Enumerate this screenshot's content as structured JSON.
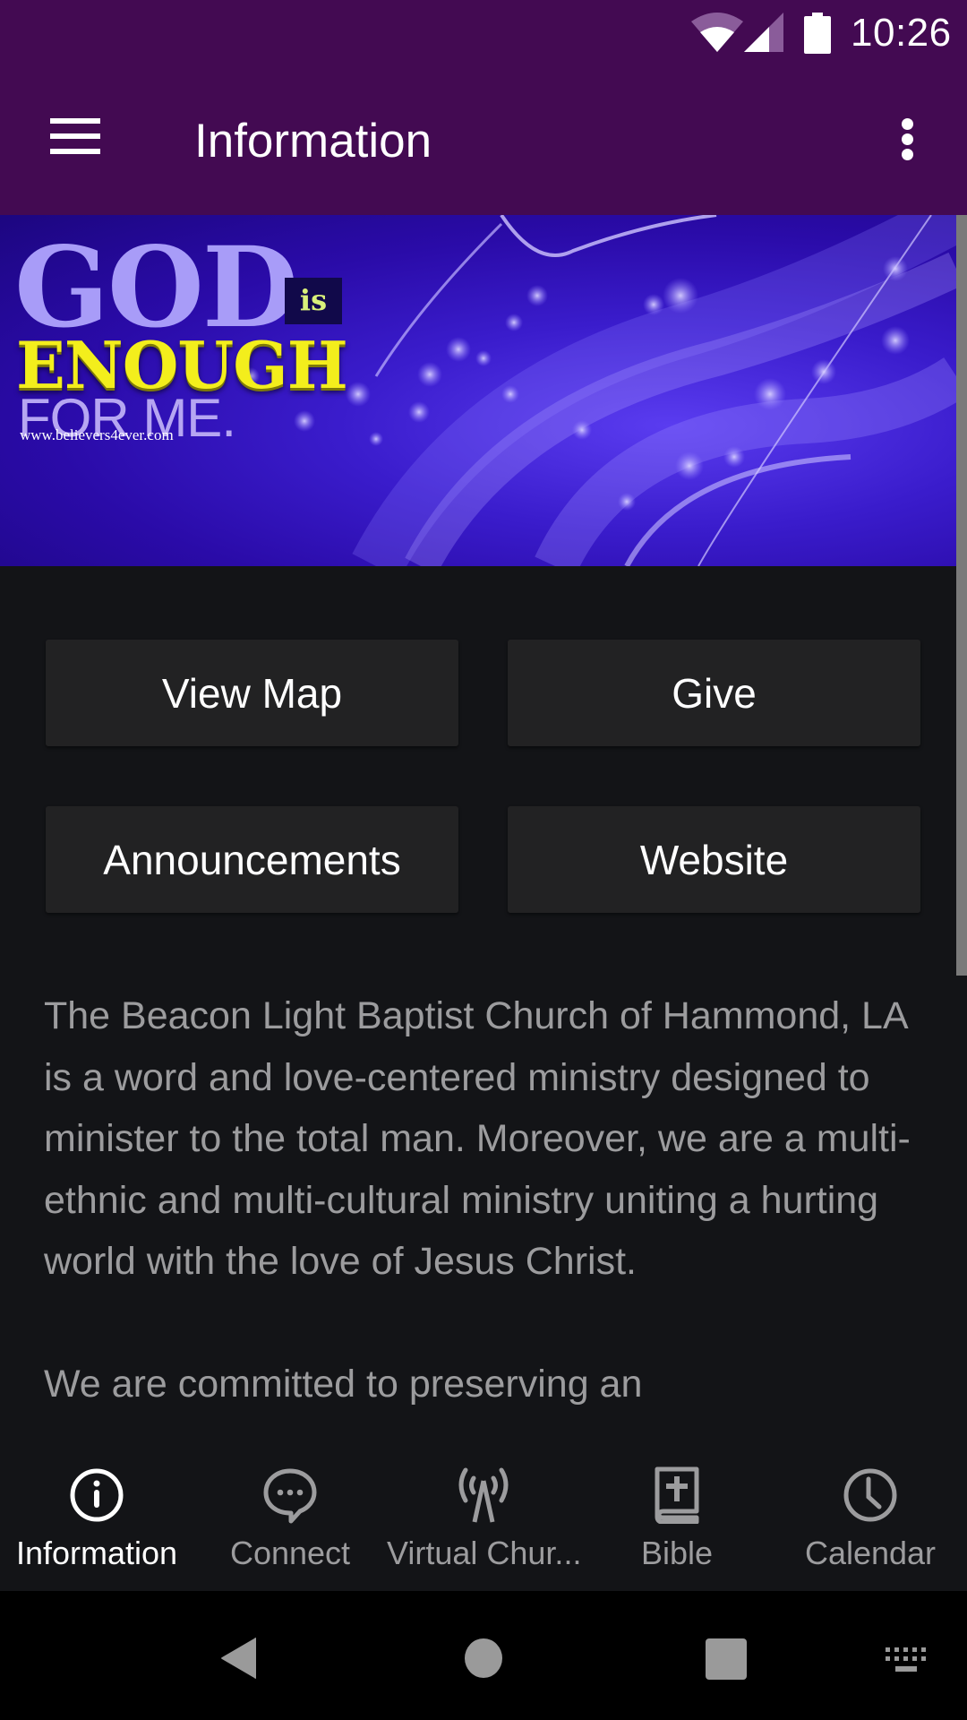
{
  "status_bar": {
    "time": "10:26",
    "icons": [
      "wifi-icon",
      "cellular-signal-icon",
      "battery-icon"
    ]
  },
  "toolbar": {
    "title": "Information",
    "menu_icon": "hamburger-menu-icon",
    "overflow_icon": "more-vertical-icon"
  },
  "banner": {
    "line1": "GOD",
    "line1_tag": "is",
    "line2": "ENOUGH",
    "line3": "FOR ME.",
    "url": "www.believers4ever.com"
  },
  "buttons": {
    "view_map": "View Map",
    "give": "Give",
    "announcements": "Announcements",
    "website": "Website"
  },
  "description": {
    "paragraphs": [
      "The Beacon Light Baptist Church of Hammond, LA is a word and love-centered ministry designed to minister to the total man. Moreover, we are a multi-ethnic and multi-cultural ministry uniting a hurting world with the love of Jesus Christ.",
      "We are committed to preserving an"
    ]
  },
  "bottom_nav": {
    "items": [
      {
        "label": "Information",
        "icon": "info-icon",
        "active": true
      },
      {
        "label": "Connect",
        "icon": "chat-bubble-icon",
        "active": false
      },
      {
        "label": "Virtual Chur...",
        "icon": "broadcast-tower-icon",
        "active": false
      },
      {
        "label": "Bible",
        "icon": "bible-book-icon",
        "active": false
      },
      {
        "label": "Calendar",
        "icon": "clock-icon",
        "active": false
      }
    ]
  },
  "system_nav": {
    "buttons": [
      "back-icon",
      "home-icon",
      "recents-icon",
      "keyboard-icon"
    ]
  },
  "colors": {
    "app_bar": "#430a52",
    "background": "#131417",
    "button": "#222223",
    "text_secondary": "#9c9c9e",
    "text_primary": "#ffffff"
  }
}
